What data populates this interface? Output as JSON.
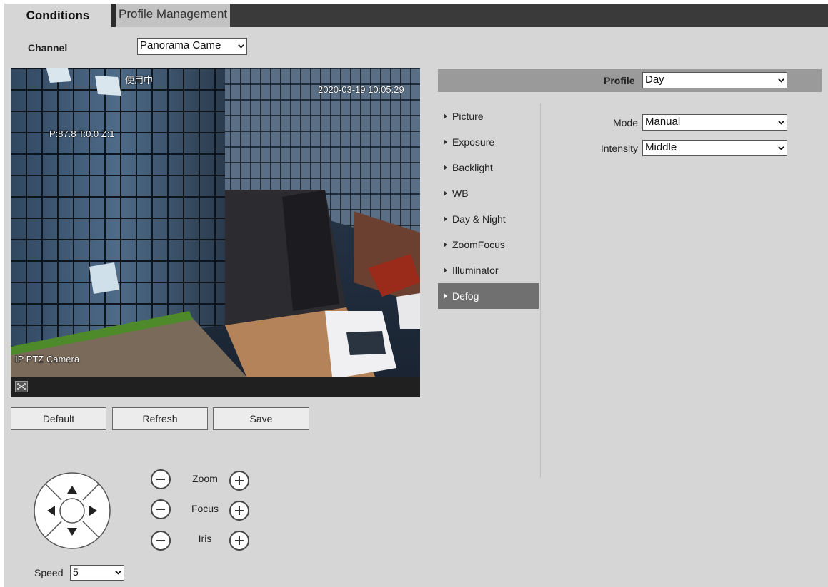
{
  "tabs": {
    "conditions": "Conditions",
    "profile_management": "Profile Management"
  },
  "channel": {
    "label": "Channel",
    "value": "Panorama Came"
  },
  "video": {
    "osd_status": "使用中",
    "osd_time": "2020-03-19 10:05:29",
    "osd_ptz": "P:87.8 T:0.0 Z:1",
    "osd_name": "IP PTZ Camera"
  },
  "buttons": {
    "default": "Default",
    "refresh": "Refresh",
    "save": "Save"
  },
  "ptz": {
    "zoom": "Zoom",
    "focus": "Focus",
    "iris": "Iris",
    "speed_label": "Speed",
    "speed_value": "5"
  },
  "profile": {
    "label": "Profile",
    "value": "Day"
  },
  "menu": [
    {
      "label": "Picture",
      "active": false
    },
    {
      "label": "Exposure",
      "active": false
    },
    {
      "label": "Backlight",
      "active": false
    },
    {
      "label": "WB",
      "active": false
    },
    {
      "label": "Day & Night",
      "active": false
    },
    {
      "label": "ZoomFocus",
      "active": false
    },
    {
      "label": "Illuminator",
      "active": false
    },
    {
      "label": "Defog",
      "active": true
    }
  ],
  "defog": {
    "mode_label": "Mode",
    "mode_value": "Manual",
    "intensity_label": "Intensity",
    "intensity_value": "Middle"
  },
  "icons": [
    "chevron-down-icon",
    "fullscreen-icon",
    "arrow-up-icon",
    "arrow-down-icon",
    "arrow-left-icon",
    "arrow-right-icon",
    "minus-icon",
    "plus-icon",
    "triangle-right-icon"
  ]
}
